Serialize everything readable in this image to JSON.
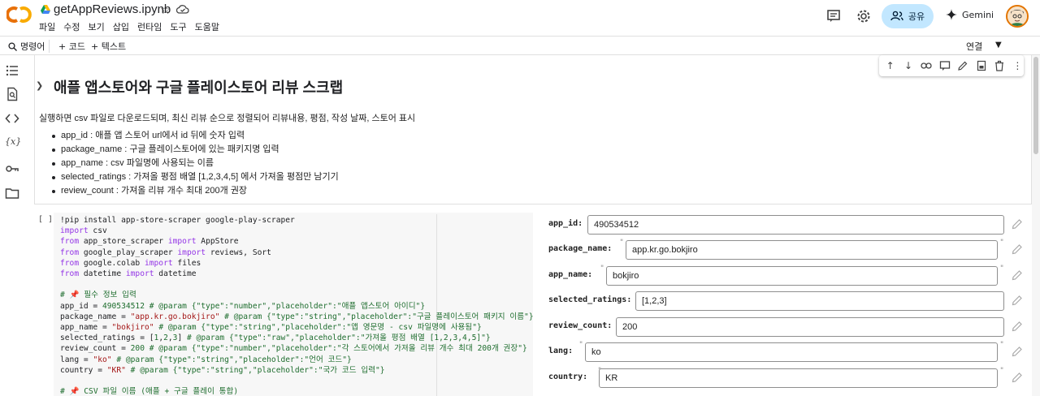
{
  "header": {
    "notebook_title": "getAppReviews.ipynb",
    "menu": [
      "파일",
      "수정",
      "보기",
      "삽입",
      "런타임",
      "도구",
      "도움말"
    ],
    "share_label": "공유",
    "gemini_label": "Gemini"
  },
  "toolbar": {
    "commands_label": "명령어",
    "add_code_label": "+ 코드",
    "add_text_label": "+ 텍스트",
    "connect_label": "연결"
  },
  "text_cell": {
    "heading": "애플 앱스토어와 구글 플레이스토어 리뷰 스크랩",
    "intro": "실행하면 csv 파일로 다운로드되며, 최신 리뷰 순으로 정렬되어 리뷰내용, 평점, 작성 날짜, 스토어 표시",
    "bullets": [
      "app_id : 애플 앱 스토어 url에서 id 뒤에 숫자 입력",
      "package_name : 구글 플레이스토어에 있는 패키지명 입력",
      "app_name : csv 파일명에 사용되는 이름",
      "selected_ratings : 가져올 평점 배열 [1,2,3,4,5] 에서 가져올 평점만 남기기",
      "review_count : 가져올 리뷰 개수 최대 200개 권장"
    ]
  },
  "code_cell": {
    "run_marker": "[ ]",
    "lines": [
      "!pip install app-store-scraper google-play-scraper",
      "import csv",
      "from app_store_scraper import AppStore",
      "from google_play_scraper import reviews, Sort",
      "from google.colab import files",
      "from datetime import datetime",
      "",
      "# 📌 필수 정보 입력",
      "app_id = 490534512 # @param {\"type\":\"number\",\"placeholder\":\"애플 앱스토어 아이디\"}",
      "package_name = \"app.kr.go.bokjiro\" # @param {\"type\":\"string\",\"placeholder\":\"구글 플레이스토어 패키지 이름\"}",
      "app_name = \"bokjiro\" # @param {\"type\":\"string\",\"placeholder\":\"앱 영문명 - csv 파일명에 사용됨\"}",
      "selected_ratings = [1,2,3] # @param {\"type\":\"raw\",\"placeholder\":\"가져올 평점 배열 [1,2,3,4,5]\"}",
      "review_count = 200 # @param {\"type\":\"number\",\"placeholder\":\"각 스토어에서 가져올 리뷰 개수 최대 200개 권장\"}",
      "lang = \"ko\" # @param {\"type\":\"string\",\"placeholder\":\"언어 코드\"}",
      "country = \"KR\" # @param {\"type\":\"string\",\"placeholder\":\"국가 코드 입력\"}",
      "",
      "# 📌 CSV 파일 이름 (애플 + 구글 플레이 통합)"
    ]
  },
  "form": {
    "app_id": {
      "label": "app_id:",
      "value": "490534512"
    },
    "package_name": {
      "label": "package_name:",
      "value": "app.kr.go.bokjiro"
    },
    "app_name": {
      "label": "app_name:",
      "value": "bokjiro"
    },
    "selected_ratings": {
      "label": "selected_ratings:",
      "value": "[1,2,3]"
    },
    "review_count": {
      "label": "review_count:",
      "value": "200"
    },
    "lang": {
      "label": "lang:",
      "value": "ko"
    },
    "country": {
      "label": "country:",
      "value": "KR"
    }
  },
  "colors": {
    "share_bg": "#c2e7ff",
    "keyword": "#9334e6",
    "comment": "#1e6d2e",
    "string": "#a31515",
    "colab_orange": "#f9ab00"
  }
}
